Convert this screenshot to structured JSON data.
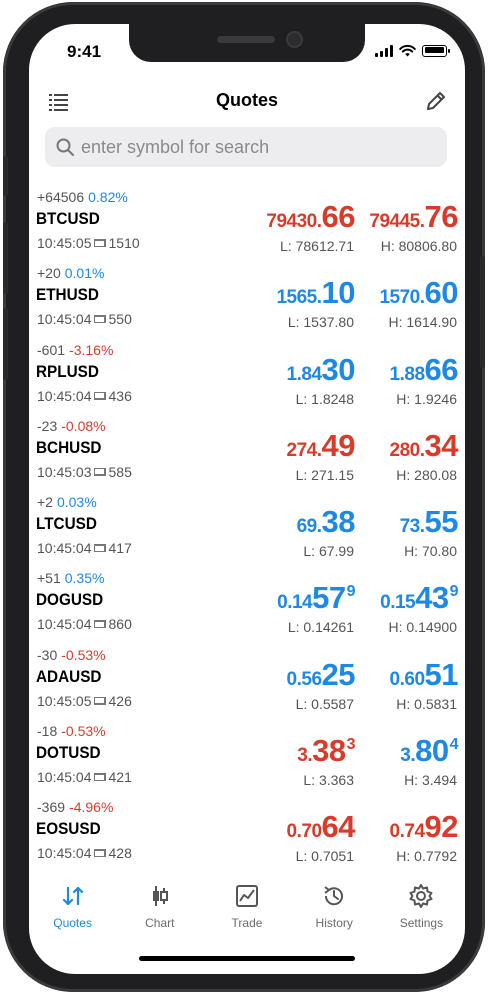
{
  "status_bar": {
    "time": "9:41"
  },
  "nav": {
    "title": "Quotes",
    "left_icon": "list-icon",
    "right_icon": "pencil-icon"
  },
  "search": {
    "placeholder": "enter symbol for search",
    "icon": "search-icon"
  },
  "colors": {
    "up": "#1e88e5",
    "down": "#d93b2b",
    "accent": "#1e88e5"
  },
  "quotes": [
    {
      "change": "+64506",
      "percent": "0.82%",
      "dir": "up",
      "symbol": "BTCUSD",
      "time": "10:45:05",
      "spread": "1510",
      "bid": {
        "small": "79430.",
        "big": "66",
        "sup": "",
        "dir": "down"
      },
      "ask": {
        "small": "79445.",
        "big": "76",
        "sup": "",
        "dir": "down"
      },
      "low": "L: 78612.71",
      "high": "H: 80806.80"
    },
    {
      "change": "+20",
      "percent": "0.01%",
      "dir": "up",
      "symbol": "ETHUSD",
      "time": "10:45:04",
      "spread": "550",
      "bid": {
        "small": "1565.",
        "big": "10",
        "sup": "",
        "dir": "up"
      },
      "ask": {
        "small": "1570.",
        "big": "60",
        "sup": "",
        "dir": "up"
      },
      "low": "L: 1537.80",
      "high": "H: 1614.90"
    },
    {
      "change": "-601",
      "percent": "-3.16%",
      "dir": "down",
      "symbol": "RPLUSD",
      "time": "10:45:04",
      "spread": "436",
      "bid": {
        "small": "1.84",
        "big": "30",
        "sup": "",
        "dir": "up"
      },
      "ask": {
        "small": "1.88",
        "big": "66",
        "sup": "",
        "dir": "up"
      },
      "low": "L: 1.8248",
      "high": "H: 1.9246"
    },
    {
      "change": "-23",
      "percent": "-0.08%",
      "dir": "down",
      "symbol": "BCHUSD",
      "time": "10:45:03",
      "spread": "585",
      "bid": {
        "small": "274.",
        "big": "49",
        "sup": "",
        "dir": "down"
      },
      "ask": {
        "small": "280.",
        "big": "34",
        "sup": "",
        "dir": "down"
      },
      "low": "L: 271.15",
      "high": "H: 280.08"
    },
    {
      "change": "+2",
      "percent": "0.03%",
      "dir": "up",
      "symbol": "LTCUSD",
      "time": "10:45:04",
      "spread": "417",
      "bid": {
        "small": "69.",
        "big": "38",
        "sup": "",
        "dir": "up"
      },
      "ask": {
        "small": "73.",
        "big": "55",
        "sup": "",
        "dir": "up"
      },
      "low": "L: 67.99",
      "high": "H: 70.80"
    },
    {
      "change": "+51",
      "percent": "0.35%",
      "dir": "up",
      "symbol": "DOGUSD",
      "time": "10:45:04",
      "spread": "860",
      "bid": {
        "small": "0.14",
        "big": "57",
        "sup": "9",
        "dir": "up"
      },
      "ask": {
        "small": "0.15",
        "big": "43",
        "sup": "9",
        "dir": "up"
      },
      "low": "L: 0.14261",
      "high": "H: 0.14900"
    },
    {
      "change": "-30",
      "percent": "-0.53%",
      "dir": "down",
      "symbol": "ADAUSD",
      "time": "10:45:05",
      "spread": "426",
      "bid": {
        "small": "0.56",
        "big": "25",
        "sup": "",
        "dir": "up"
      },
      "ask": {
        "small": "0.60",
        "big": "51",
        "sup": "",
        "dir": "up"
      },
      "low": "L: 0.5587",
      "high": "H: 0.5831"
    },
    {
      "change": "-18",
      "percent": "-0.53%",
      "dir": "down",
      "symbol": "DOTUSD",
      "time": "10:45:04",
      "spread": "421",
      "bid": {
        "small": "3.",
        "big": "38",
        "sup": "3",
        "dir": "down"
      },
      "ask": {
        "small": "3.",
        "big": "80",
        "sup": "4",
        "dir": "up"
      },
      "low": "L: 3.363",
      "high": "H: 3.494"
    },
    {
      "change": "-369",
      "percent": "-4.96%",
      "dir": "down",
      "symbol": "EOSUSD",
      "time": "10:45:04",
      "spread": "428",
      "bid": {
        "small": "0.70",
        "big": "64",
        "sup": "",
        "dir": "down"
      },
      "ask": {
        "small": "0.74",
        "big": "92",
        "sup": "",
        "dir": "down"
      },
      "low": "L: 0.7051",
      "high": "H: 0.7792"
    }
  ],
  "tabbar": [
    {
      "label": "Quotes",
      "icon": "quotes-icon",
      "active": true
    },
    {
      "label": "Chart",
      "icon": "chart-icon",
      "active": false
    },
    {
      "label": "Trade",
      "icon": "trade-icon",
      "active": false
    },
    {
      "label": "History",
      "icon": "history-icon",
      "active": false
    },
    {
      "label": "Settings",
      "icon": "settings-icon",
      "active": false
    }
  ]
}
